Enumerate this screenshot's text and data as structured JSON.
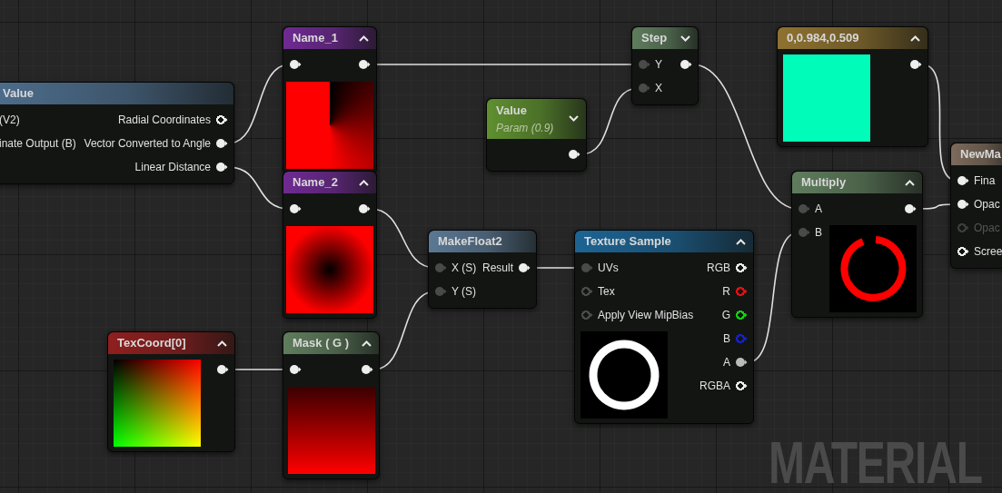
{
  "nodes": [
    {
      "title": "Value",
      "color": "#4d6d8c",
      "inputs": [
        {
          "label": "(V2)"
        },
        {
          "label": "inate Output (B)"
        }
      ],
      "outputs": [
        {
          "label": "Radial Coordinates",
          "connected": false
        },
        {
          "label": "Vector Converted to Angle",
          "connected": true
        },
        {
          "label": "Linear Distance",
          "connected": true
        }
      ]
    },
    {
      "title": "Name_1",
      "color": "#6f2a93",
      "expanded": true,
      "inputs": [
        {
          "connected": true,
          "color": "#eeeeee"
        }
      ],
      "outputs": [
        {
          "connected": true
        }
      ],
      "preview": {
        "kind": "angle"
      }
    },
    {
      "title": "Name_2",
      "color": "#6f2a93",
      "expanded": true,
      "inputs": [
        {
          "connected": true,
          "color": "#eeeeee"
        }
      ],
      "outputs": [
        {
          "connected": true
        }
      ],
      "preview": {
        "kind": "distance"
      }
    },
    {
      "title": "TexCoord[0]",
      "color": "#8f1f1f",
      "expanded": true,
      "outputs": [
        {
          "connected": true
        }
      ],
      "preview": {
        "kind": "texcoord"
      }
    },
    {
      "title": "Mask ( G )",
      "color": "#5f7d5d",
      "expanded": true,
      "inputs": [
        {
          "connected": true,
          "color": "#eeeeee"
        }
      ],
      "outputs": [
        {
          "connected": true
        }
      ],
      "preview": {
        "kind": "mask"
      }
    },
    {
      "title": "MakeFloat2",
      "color": "#5b7893",
      "inputs": [
        {
          "label": "X (S)",
          "connected": true
        },
        {
          "label": "Y (S)",
          "connected": true
        }
      ],
      "outputs": [
        {
          "label": "Result",
          "connected": true
        }
      ]
    },
    {
      "title": "Value",
      "subtitle": "Param (0.9)",
      "color": "#5f9030",
      "expanded": false,
      "outputs": [
        {
          "connected": true
        }
      ]
    },
    {
      "title": "Step",
      "color": "#5f7d5d",
      "expanded": false,
      "inputs": [
        {
          "label": "Y",
          "connected": true
        },
        {
          "label": "X",
          "connected": true
        }
      ],
      "outputs": [
        {
          "connected": true
        }
      ]
    },
    {
      "title": "Texture Sample",
      "color": "#1d6494",
      "expanded": true,
      "inputs": [
        {
          "label": "UVs",
          "connected": true
        },
        {
          "label": "Tex",
          "connected": false
        },
        {
          "label": "Apply View MipBias",
          "connected": false
        }
      ],
      "outputs": [
        {
          "label": "RGB",
          "connected": false
        },
        {
          "label": "R",
          "connected": false,
          "color": "#e01010"
        },
        {
          "label": "G",
          "connected": false,
          "color": "#10d010"
        },
        {
          "label": "B",
          "connected": false,
          "color": "#1020e0"
        },
        {
          "label": "A",
          "connected": true,
          "color": "#bbbbbb"
        },
        {
          "label": "RGBA",
          "connected": false
        }
      ],
      "preview": {
        "kind": "ring"
      }
    },
    {
      "title": "0,0.984,0.509",
      "color": "#8f7230",
      "expanded": true,
      "outputs": [
        {
          "connected": true
        }
      ],
      "preview": {
        "kind": "swatch",
        "color": "#00fcb9"
      }
    },
    {
      "title": "Multiply",
      "color": "#5f7d5d",
      "expanded": true,
      "inputs": [
        {
          "label": "A",
          "connected": true
        },
        {
          "label": "B",
          "connected": true
        }
      ],
      "outputs": [
        {
          "connected": true
        }
      ],
      "preview": {
        "kind": "ring-cut"
      }
    },
    {
      "title": "NewMa",
      "color": "#7d6b5c",
      "kind": "result",
      "inputs": [
        {
          "label": "Fina",
          "connected": true
        },
        {
          "label": "Opac",
          "connected": true
        },
        {
          "label": "Opac",
          "connected": false,
          "disabled": true
        },
        {
          "label": "Scree",
          "connected": false
        }
      ]
    }
  ],
  "graph_label": "MATERIAL"
}
